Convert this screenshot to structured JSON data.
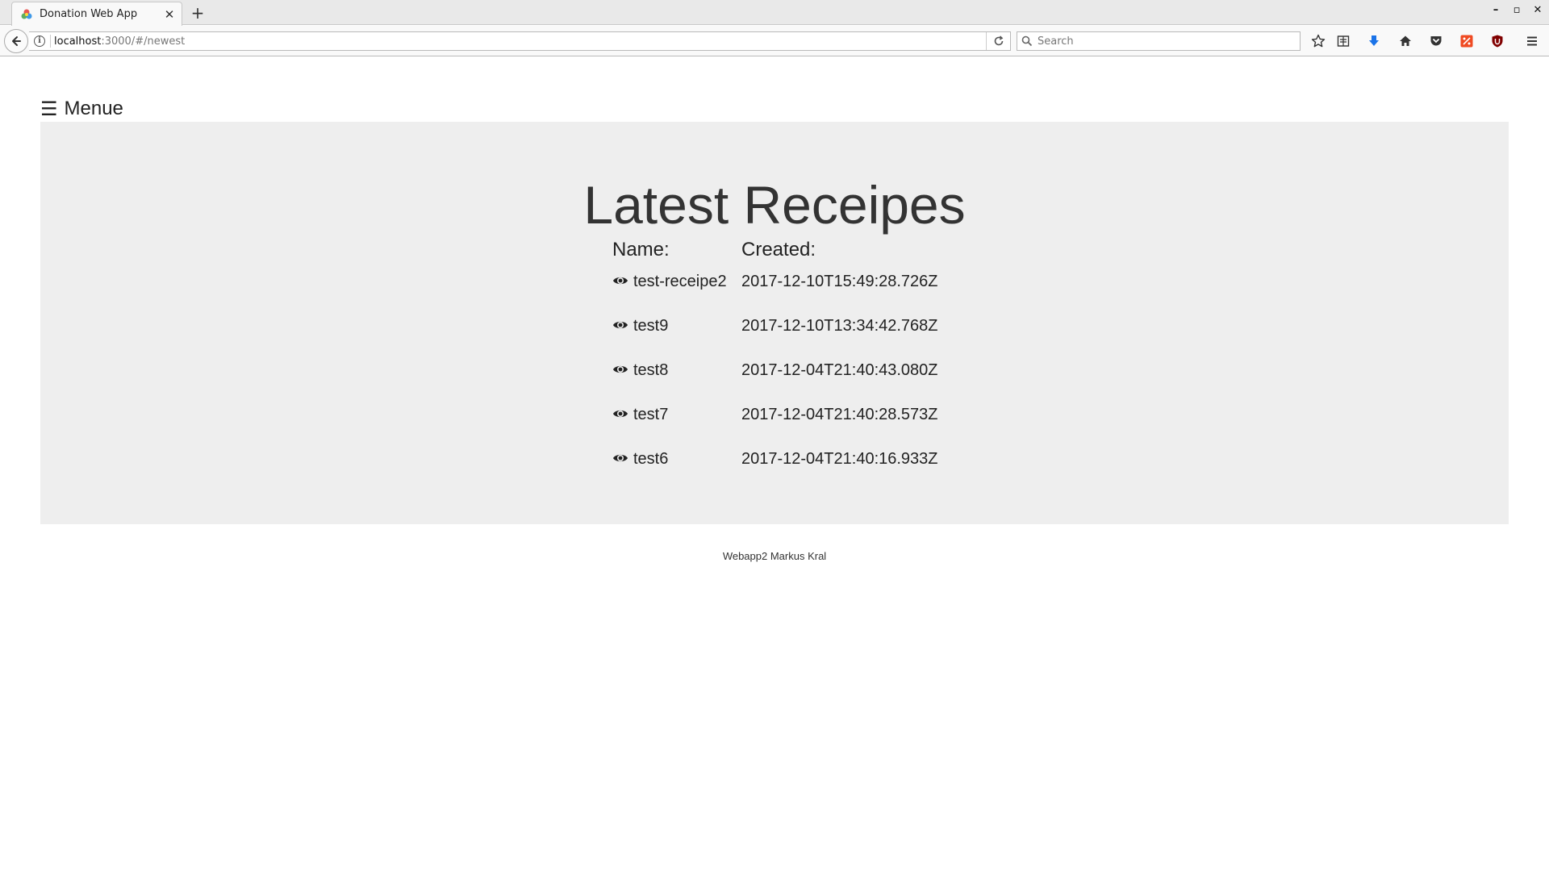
{
  "browser": {
    "tab_title": "Donation Web App",
    "new_tab_label": "+",
    "url_host": "localhost",
    "url_path": ":3000/#/newest",
    "search_placeholder": "Search",
    "window_controls": [
      "–",
      "▫",
      "✕"
    ],
    "toolbar_icons": [
      "bookmark-star-icon",
      "reading-list-icon",
      "downloads-icon",
      "home-icon",
      "pocket-icon",
      "shopping-addon-icon",
      "ublock-icon",
      "hamburger-menu-icon"
    ]
  },
  "page": {
    "menu_label": "Menue",
    "title": "Latest Receipes",
    "columns": {
      "name": "Name:",
      "created": "Created:"
    },
    "rows": [
      {
        "name": "test-receipe2",
        "created": "2017-12-10T15:49:28.726Z"
      },
      {
        "name": "test9",
        "created": "2017-12-10T13:34:42.768Z"
      },
      {
        "name": "test8",
        "created": "2017-12-04T21:40:43.080Z"
      },
      {
        "name": "test7",
        "created": "2017-12-04T21:40:28.573Z"
      },
      {
        "name": "test6",
        "created": "2017-12-04T21:40:16.933Z"
      }
    ],
    "footer": "Webapp2 Markus Kral"
  },
  "colors": {
    "jumbotron_bg": "#eeeeee",
    "download_icon": "#1a73e8",
    "addon_orange": "#ef4b23",
    "ublock_red": "#800000"
  }
}
